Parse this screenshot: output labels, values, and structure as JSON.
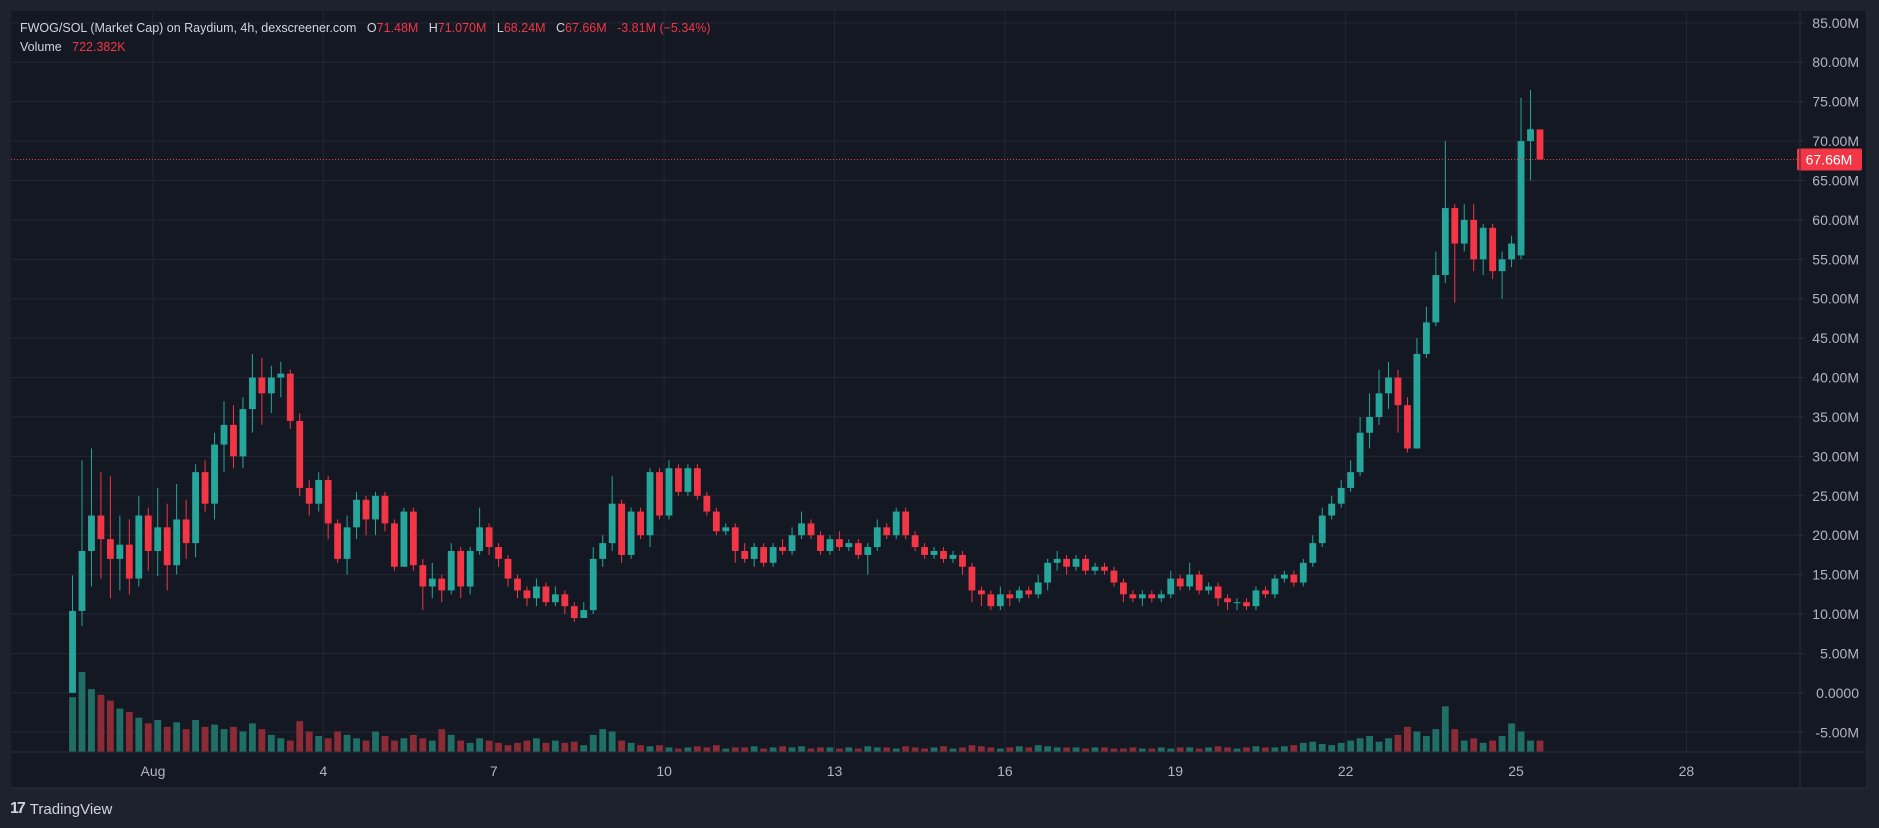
{
  "legend": {
    "symbol": "FWOG/SOL (Market Cap) on Raydium, 4h, dexscreener.com",
    "open_key": "O",
    "open": "71.48M",
    "high_key": "H",
    "high": "71.070M",
    "low_key": "L",
    "low": "68.24M",
    "close_key": "C",
    "close": "67.66M",
    "change": "-3.81M (−5.34%)",
    "volume_label": "Volume",
    "volume": "722.382K"
  },
  "brand": {
    "logo_glyph": "17",
    "name": "TradingView"
  },
  "chart_data": {
    "type": "candlestick",
    "unit": "M",
    "y_ticks": [
      "85.00M",
      "80.00M",
      "75.00M",
      "70.00M",
      "65.00M",
      "60.00M",
      "55.00M",
      "50.00M",
      "45.00M",
      "40.00M",
      "35.00M",
      "30.00M",
      "25.00M",
      "20.00M",
      "15.00M",
      "10.00M",
      "5.00M",
      "0.0000",
      "-5.00M"
    ],
    "y_range": [
      -7.5,
      86.5
    ],
    "x_ticks": [
      {
        "label": "Aug",
        "day": 1
      },
      {
        "label": "4",
        "day": 4
      },
      {
        "label": "7",
        "day": 7
      },
      {
        "label": "10",
        "day": 10
      },
      {
        "label": "13",
        "day": 13
      },
      {
        "label": "16",
        "day": 16
      },
      {
        "label": "19",
        "day": 19
      },
      {
        "label": "22",
        "day": 22
      },
      {
        "label": "25",
        "day": 25
      },
      {
        "label": "28",
        "day": 28
      }
    ],
    "x_range_days": [
      -1.5,
      30.0
    ],
    "first_candle_day": -0.4167,
    "candle_interval_days": 0.1667,
    "last_price": "67.66M",
    "last_price_value": 67.66,
    "up_color": "#26a69a",
    "down_color": "#f23645",
    "volume_up_color": "#1f6f67",
    "volume_down_color": "#8a2b36",
    "candles": [
      [
        0,
        10.4,
        14.9,
        0,
        10.4
      ],
      [
        10.4,
        18.0,
        29.5,
        8.5,
        14.5
      ],
      [
        18.0,
        22.5,
        31.0,
        13.5,
        14.0
      ],
      [
        22.5,
        19.5,
        28.0,
        14.5,
        17.2
      ],
      [
        19.5,
        17.0,
        27.5,
        12.0,
        14.2
      ],
      [
        17.0,
        18.8,
        22.5,
        13.0,
        13.5
      ],
      [
        18.8,
        14.5,
        22.0,
        12.5,
        14.0
      ],
      [
        14.5,
        22.5,
        25.0,
        13.5,
        14.0
      ],
      [
        22.5,
        18.0,
        23.5,
        15.5,
        15.8
      ],
      [
        18.0,
        21.0,
        26.0,
        14.8,
        15.5
      ],
      [
        21.0,
        16.2,
        24.0,
        13.0,
        14.3
      ],
      [
        16.2,
        22.0,
        26.5,
        15.0,
        17.0
      ],
      [
        22.0,
        19.0,
        24.5,
        17.0,
        17.0
      ],
      [
        19.0,
        28.0,
        29.0,
        17.2,
        18.5
      ],
      [
        28.0,
        24.0,
        29.5,
        23.0,
        23.5
      ],
      [
        24.0,
        31.5,
        33.0,
        22.0,
        25.5
      ],
      [
        31.5,
        34.0,
        37.0,
        28.0,
        29.0
      ],
      [
        34.0,
        30.0,
        36.5,
        28.5,
        29.5
      ],
      [
        30.0,
        36.0,
        37.5,
        28.5,
        30.0
      ],
      [
        36.0,
        40.0,
        43.0,
        33.0,
        34.5
      ],
      [
        40.0,
        38.0,
        42.5,
        34.0,
        36.0
      ],
      [
        38.0,
        40.0,
        41.5,
        35.5,
        37.5
      ],
      [
        40.0,
        40.5,
        42.0,
        37.5,
        38.5
      ],
      [
        40.5,
        34.5,
        41.0,
        33.5,
        34.0
      ],
      [
        34.5,
        26.0,
        35.5,
        25.0,
        25.5
      ],
      [
        26.0,
        24.0,
        27.0,
        22.5,
        23.0
      ],
      [
        24.0,
        27.0,
        28.0,
        23.0,
        23.5
      ],
      [
        27.0,
        21.5,
        27.5,
        19.5,
        20.0
      ],
      [
        21.5,
        17.0,
        22.0,
        16.5,
        16.8
      ],
      [
        17.0,
        21.0,
        22.5,
        15.0,
        16.0
      ],
      [
        21.0,
        24.5,
        25.5,
        19.5,
        20.0
      ],
      [
        24.5,
        22.0,
        25.0,
        20.0,
        21.0
      ],
      [
        22.0,
        25.0,
        25.5,
        20.0,
        21.0
      ],
      [
        25.0,
        21.5,
        25.5,
        20.5,
        21.0
      ],
      [
        21.5,
        16.0,
        22.0,
        15.5,
        15.8
      ],
      [
        16.0,
        23.0,
        23.5,
        16.0,
        16.3
      ],
      [
        23.0,
        16.2,
        23.5,
        15.5,
        16.0
      ],
      [
        16.2,
        13.5,
        17.0,
        10.5,
        11.5
      ],
      [
        13.5,
        14.5,
        16.5,
        12.0,
        13.0
      ],
      [
        14.5,
        13.0,
        15.0,
        11.5,
        12.0
      ],
      [
        13.0,
        18.0,
        19.0,
        12.5,
        13.0
      ],
      [
        18.0,
        13.5,
        18.5,
        12.0,
        12.5
      ],
      [
        13.5,
        18.0,
        18.5,
        12.5,
        13.0
      ],
      [
        18.0,
        21.0,
        23.5,
        17.5,
        18.0
      ],
      [
        21.0,
        18.5,
        21.5,
        17.5,
        18.0
      ],
      [
        18.5,
        17.0,
        19.0,
        16.0,
        16.5
      ],
      [
        17.0,
        14.5,
        17.5,
        13.5,
        14.0
      ],
      [
        14.5,
        13.0,
        15.0,
        12.0,
        12.5
      ],
      [
        13.0,
        12.0,
        13.5,
        11.0,
        11.5
      ],
      [
        12.0,
        13.5,
        14.5,
        11.0,
        11.5
      ],
      [
        13.5,
        11.5,
        14.0,
        11.0,
        11.0
      ],
      [
        11.5,
        12.5,
        13.5,
        11.0,
        11.0
      ],
      [
        12.5,
        11.0,
        13.0,
        10.0,
        10.5
      ],
      [
        11.0,
        9.5,
        11.5,
        9.0,
        9.0
      ],
      [
        9.5,
        10.5,
        11.5,
        9.5,
        9.5
      ],
      [
        10.5,
        17.0,
        18.5,
        10.0,
        10.5
      ],
      [
        17.0,
        19.0,
        20.0,
        16.0,
        17.0
      ],
      [
        19.0,
        24.0,
        27.5,
        18.0,
        18.5
      ],
      [
        24.0,
        17.5,
        24.5,
        16.5,
        17.0
      ],
      [
        17.5,
        23.0,
        23.5,
        17.0,
        17.5
      ],
      [
        23.0,
        20.0,
        23.5,
        19.5,
        20.0
      ],
      [
        20.0,
        28.0,
        28.5,
        18.5,
        19.0
      ],
      [
        28.0,
        22.5,
        28.5,
        22.0,
        22.5
      ],
      [
        22.5,
        28.5,
        29.5,
        22.0,
        22.5
      ],
      [
        28.5,
        25.5,
        29.0,
        25.0,
        25.3
      ],
      [
        25.5,
        28.5,
        29.0,
        25.0,
        25.3
      ],
      [
        28.5,
        25.0,
        29.0,
        24.5,
        24.8
      ],
      [
        25.0,
        23.0,
        25.5,
        22.5,
        22.8
      ],
      [
        23.0,
        20.5,
        23.5,
        20.0,
        20.3
      ],
      [
        20.5,
        21.0,
        21.5,
        20.0,
        20.3
      ],
      [
        21.0,
        18.0,
        21.5,
        16.5,
        17.0
      ],
      [
        18.0,
        17.0,
        19.0,
        16.5,
        16.8
      ],
      [
        17.0,
        18.5,
        19.0,
        16.0,
        16.5
      ],
      [
        18.5,
        16.5,
        19.0,
        16.0,
        16.3
      ],
      [
        16.5,
        18.5,
        19.0,
        16.0,
        16.3
      ],
      [
        18.5,
        18.0,
        19.5,
        17.5,
        17.8
      ],
      [
        18.0,
        20.0,
        21.0,
        17.5,
        18.0
      ],
      [
        20.0,
        21.5,
        23.0,
        19.5,
        20.0
      ],
      [
        21.5,
        20.0,
        22.0,
        19.5,
        19.8
      ],
      [
        20.0,
        18.0,
        20.5,
        17.5,
        17.8
      ],
      [
        18.0,
        19.5,
        20.0,
        17.5,
        18.0
      ],
      [
        19.5,
        18.5,
        20.5,
        18.0,
        18.3
      ],
      [
        18.5,
        19.0,
        19.5,
        18.0,
        18.3
      ],
      [
        19.0,
        17.5,
        19.5,
        17.0,
        17.3
      ],
      [
        17.5,
        18.5,
        19.0,
        15.0,
        16.5
      ],
      [
        18.5,
        21.0,
        22.0,
        18.0,
        18.5
      ],
      [
        21.0,
        20.0,
        21.5,
        19.5,
        19.8
      ],
      [
        20.0,
        23.0,
        23.5,
        19.5,
        20.0
      ],
      [
        23.0,
        20.0,
        23.5,
        19.5,
        19.8
      ],
      [
        20.0,
        18.5,
        20.5,
        18.0,
        18.3
      ],
      [
        18.5,
        17.5,
        19.0,
        17.0,
        17.3
      ],
      [
        17.5,
        18.0,
        18.5,
        17.0,
        17.3
      ],
      [
        18.0,
        17.0,
        18.5,
        16.5,
        16.8
      ],
      [
        17.0,
        17.5,
        18.0,
        16.5,
        16.8
      ],
      [
        17.5,
        16.0,
        18.0,
        15.0,
        15.5
      ],
      [
        16.0,
        13.0,
        16.5,
        11.5,
        12.0
      ],
      [
        13.0,
        12.5,
        13.5,
        11.0,
        11.5
      ],
      [
        12.5,
        11.0,
        13.0,
        10.5,
        10.8
      ],
      [
        11.0,
        12.5,
        13.5,
        10.5,
        10.8
      ],
      [
        12.5,
        12.0,
        13.0,
        11.0,
        11.5
      ],
      [
        12.0,
        13.0,
        13.5,
        11.5,
        12.0
      ],
      [
        13.0,
        12.5,
        13.5,
        12.0,
        12.3
      ],
      [
        12.5,
        14.0,
        15.0,
        12.0,
        12.5
      ],
      [
        14.0,
        16.5,
        17.0,
        13.0,
        13.5
      ],
      [
        16.5,
        17.0,
        18.0,
        15.5,
        16.0
      ],
      [
        17.0,
        16.0,
        17.5,
        15.0,
        15.5
      ],
      [
        16.0,
        17.0,
        17.5,
        15.5,
        15.8
      ],
      [
        17.0,
        15.5,
        17.5,
        15.0,
        15.3
      ],
      [
        15.5,
        16.0,
        16.5,
        15.0,
        15.3
      ],
      [
        16.0,
        15.5,
        16.5,
        15.0,
        15.3
      ],
      [
        15.5,
        14.0,
        16.0,
        13.5,
        13.8
      ],
      [
        14.0,
        12.5,
        14.5,
        11.5,
        12.0
      ],
      [
        12.5,
        12.0,
        13.0,
        11.5,
        11.8
      ],
      [
        12.0,
        12.5,
        13.0,
        11.0,
        11.5
      ],
      [
        12.5,
        12.0,
        13.0,
        11.5,
        11.8
      ],
      [
        12.0,
        12.5,
        13.0,
        11.5,
        11.8
      ],
      [
        12.5,
        14.5,
        15.5,
        12.0,
        12.5
      ],
      [
        14.5,
        13.5,
        15.0,
        13.0,
        13.3
      ],
      [
        13.5,
        15.0,
        16.5,
        13.0,
        13.5
      ],
      [
        15.0,
        13.0,
        15.5,
        12.5,
        12.8
      ],
      [
        13.0,
        13.5,
        14.0,
        12.5,
        12.8
      ],
      [
        13.5,
        12.0,
        14.0,
        11.0,
        11.5
      ],
      [
        12.0,
        11.5,
        12.5,
        10.5,
        11.0
      ],
      [
        11.5,
        11.5,
        12.0,
        10.5,
        11.0
      ],
      [
        11.5,
        11.0,
        12.0,
        10.5,
        10.8
      ],
      [
        11.0,
        13.0,
        13.5,
        10.5,
        11.0
      ],
      [
        13.0,
        12.5,
        13.5,
        12.0,
        12.3
      ],
      [
        12.5,
        14.5,
        15.0,
        12.0,
        12.5
      ],
      [
        14.5,
        15.0,
        15.5,
        14.0,
        14.3
      ],
      [
        15.0,
        14.0,
        15.5,
        13.5,
        13.8
      ],
      [
        14.0,
        16.5,
        17.0,
        13.5,
        14.0
      ],
      [
        16.5,
        19.0,
        20.0,
        16.0,
        16.5
      ],
      [
        19.0,
        22.5,
        23.5,
        18.5,
        19.0
      ],
      [
        22.5,
        24.0,
        25.0,
        22.0,
        22.5
      ],
      [
        24.0,
        26.0,
        27.0,
        23.5,
        24.0
      ],
      [
        26.0,
        28.0,
        29.5,
        25.5,
        26.0
      ],
      [
        28.0,
        33.0,
        35.0,
        27.5,
        28.0
      ],
      [
        33.0,
        35.0,
        38.0,
        31.0,
        32.0
      ],
      [
        35.0,
        38.0,
        41.0,
        34.0,
        34.5
      ],
      [
        38.0,
        40.0,
        42.0,
        36.0,
        37.0
      ],
      [
        40.0,
        36.5,
        41.0,
        33.0,
        34.0
      ],
      [
        36.5,
        31.0,
        37.5,
        30.5,
        31.0
      ],
      [
        31.0,
        43.0,
        45.0,
        31.0,
        31.5
      ],
      [
        43.0,
        47.0,
        49.0,
        42.5,
        43.0
      ],
      [
        47.0,
        53.0,
        56.0,
        46.5,
        47.0
      ],
      [
        53.0,
        61.5,
        70.0,
        52.0,
        53.0
      ],
      [
        61.5,
        57.0,
        62.0,
        49.5,
        51.0
      ],
      [
        57.0,
        60.0,
        62.0,
        56.0,
        56.5
      ],
      [
        60.0,
        55.0,
        62.0,
        53.5,
        54.0
      ],
      [
        55.0,
        59.0,
        59.5,
        53.0,
        54.0
      ],
      [
        59.0,
        53.5,
        59.5,
        52.5,
        53.0
      ],
      [
        53.5,
        55.0,
        56.0,
        50.0,
        51.5
      ],
      [
        55.0,
        57.0,
        58.0,
        54.0,
        54.5
      ],
      [
        55.5,
        70.0,
        75.5,
        55.0,
        55.5
      ],
      [
        70.0,
        71.5,
        76.5,
        65.0,
        66.0
      ],
      [
        71.48,
        67.66,
        71.07,
        68.24,
        68.24
      ]
    ],
    "volumes": [
      48,
      70,
      55,
      50,
      45,
      38,
      35,
      30,
      25,
      28,
      22,
      26,
      20,
      28,
      22,
      24,
      20,
      22,
      18,
      25,
      20,
      15,
      12,
      10,
      27,
      18,
      14,
      12,
      18,
      15,
      12,
      10,
      18,
      14,
      10,
      12,
      15,
      12,
      10,
      20,
      15,
      10,
      8,
      12,
      10,
      8,
      6,
      8,
      10,
      12,
      8,
      10,
      8,
      9,
      6,
      15,
      20,
      18,
      10,
      8,
      6,
      5,
      6,
      4,
      3,
      4,
      5,
      4,
      6,
      3,
      4,
      4,
      5,
      3,
      4,
      5,
      4,
      5,
      3,
      4,
      4,
      3,
      4,
      3,
      5,
      4,
      4,
      3,
      5,
      4,
      3,
      4,
      5,
      3,
      4,
      6,
      5,
      4,
      3,
      4,
      5,
      4,
      6,
      5,
      4,
      4,
      4,
      3,
      4,
      4,
      3,
      3,
      4,
      3,
      3,
      4,
      3,
      4,
      4,
      3,
      4,
      5,
      4,
      3,
      4,
      5,
      4,
      4,
      5,
      6,
      8,
      9,
      7,
      6,
      8,
      10,
      12,
      14,
      9,
      12,
      15,
      22,
      18,
      14,
      20,
      40,
      20,
      10,
      12,
      8,
      10,
      14,
      25,
      18,
      10,
      10
    ]
  }
}
